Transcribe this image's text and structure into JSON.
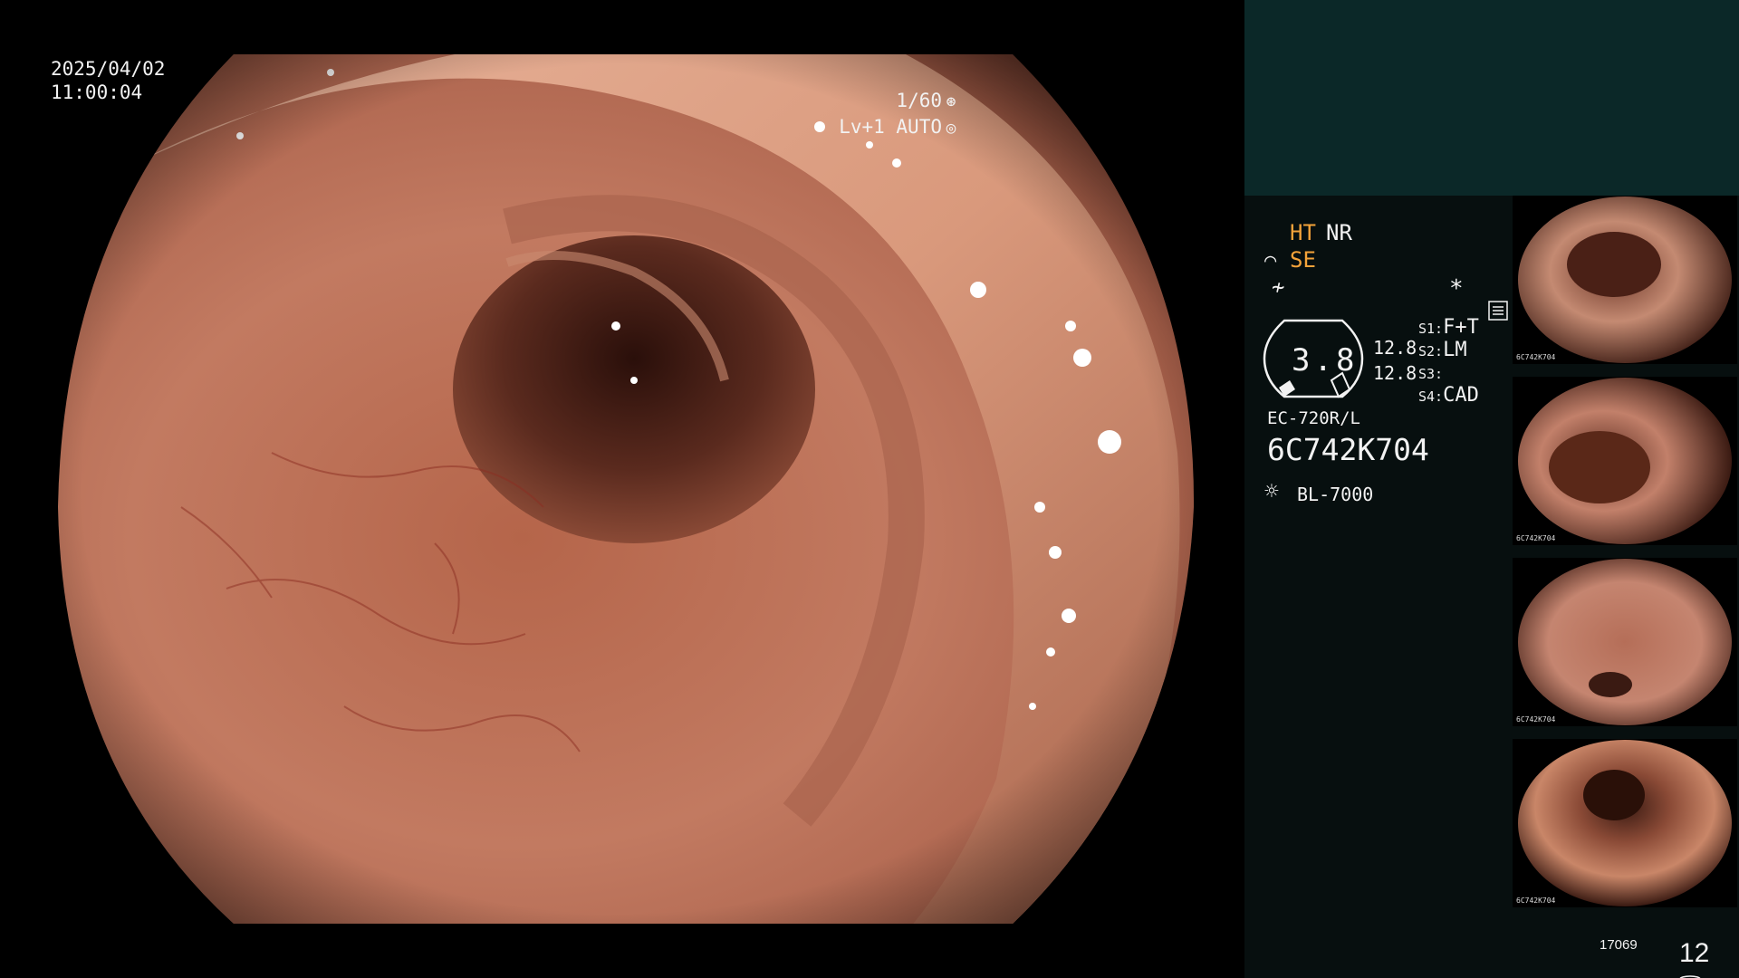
{
  "overlay": {
    "date": "2025/04/02",
    "time": "11:00:04",
    "shutter": "1/60",
    "shutter_icon": "shutter-icon",
    "level": "Lv+1 AUTO",
    "level_icon": "auto-iris-icon"
  },
  "status": {
    "ht": "HT",
    "nr": "NR",
    "se": "SE",
    "se_icon": "structure-enhancement-icon",
    "enh_icon": "enhancement-icon",
    "menu_icon": "menu-icon",
    "asterisk": "*",
    "gauge_value": "3.8",
    "gauge_sub1": "12.8",
    "gauge_sub2": "12.8",
    "switches": [
      {
        "key": "S1:",
        "value": "F+T"
      },
      {
        "key": "S2:",
        "value": "LM"
      },
      {
        "key": "S3:",
        "value": ""
      },
      {
        "key": "S4:",
        "value": "CAD"
      }
    ],
    "scope_model": "EC-720R/L",
    "scope_serial": "6C742K704",
    "light_icon": "lamp-icon",
    "light_source": "BL-7000"
  },
  "thumbnails": [
    {
      "label": "6C742K704"
    },
    {
      "label": "6C742K704"
    },
    {
      "label": "6C742K704"
    },
    {
      "label": "6C742K704"
    }
  ],
  "footer": {
    "counter_small": "17069",
    "storage_icon": "storage-icon",
    "counter_large": "12"
  },
  "colors": {
    "accent_orange": "#f4a33a",
    "panel_top": "#0b2828",
    "panel_bottom": "#070f0f"
  }
}
